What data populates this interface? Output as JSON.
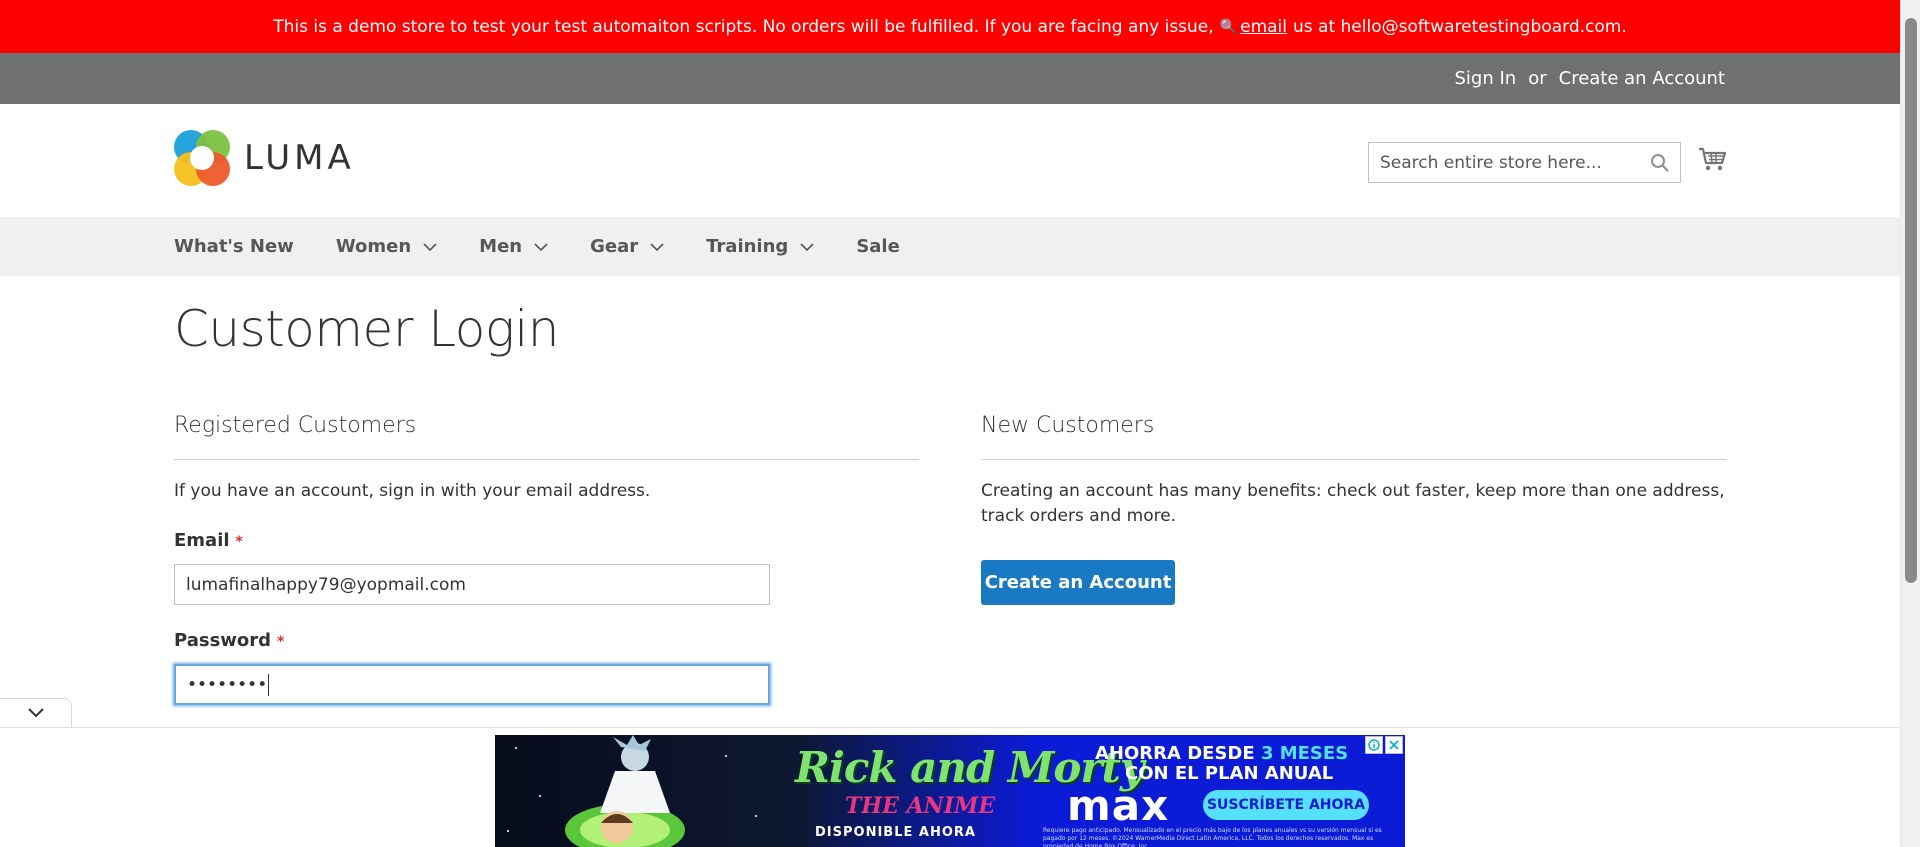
{
  "banner": {
    "text": "This is a demo store to test your test automaiton scripts. No orders will be fulfilled. If you are facing any issue,",
    "email_link": "email",
    "suffix": "us at hello@softwaretestingboard.com."
  },
  "topbar": {
    "sign_in": "Sign In",
    "or": "or",
    "create_account": "Create an Account"
  },
  "header": {
    "logo_text": "LUMA",
    "search_placeholder": "Search entire store here..."
  },
  "nav": {
    "items": [
      {
        "label": "What's New",
        "has_menu": false
      },
      {
        "label": "Women",
        "has_menu": true
      },
      {
        "label": "Men",
        "has_menu": true
      },
      {
        "label": "Gear",
        "has_menu": true
      },
      {
        "label": "Training",
        "has_menu": true
      },
      {
        "label": "Sale",
        "has_menu": false
      }
    ]
  },
  "page": {
    "title": "Customer Login"
  },
  "registered": {
    "title": "Registered Customers",
    "intro": "If you have an account, sign in with your email address.",
    "email_label": "Email",
    "email_value": "lumafinalhappy79@yopmail.com",
    "password_label": "Password",
    "password_value": "••••••••",
    "required_mark": "*"
  },
  "new_customers": {
    "title": "New Customers",
    "intro": "Creating an account has many benefits: check out faster, keep more than one address, track orders and more.",
    "create_button": "Create an Account"
  },
  "ad": {
    "title": "Rick and Morty",
    "subtitle": "THE ANIME",
    "available": "DISPONIBLE AHORA",
    "promo_prefix": "AHORRA DESDE",
    "promo_highlight": "3 MESES",
    "promo_line2": "CON EL PLAN ANUAL",
    "brand": "max",
    "cta": "SUSCRÍBETE AHORA",
    "fine_print": "Requiere pago anticipado. Mensualizado en el precio más bajo de los planes anuales vs su versión mensual si es pagado por 12 meses. ©2024 WarnerMedia Direct Latin America, LLC. Todos los derechos reservados. Max es propiedad de Home Box Office, Inc."
  },
  "colors": {
    "banner": "#ff0000",
    "topbar": "#6e716e",
    "primary_button": "#1979c3",
    "required": "#e02b27",
    "focus": "#68a8e0"
  }
}
